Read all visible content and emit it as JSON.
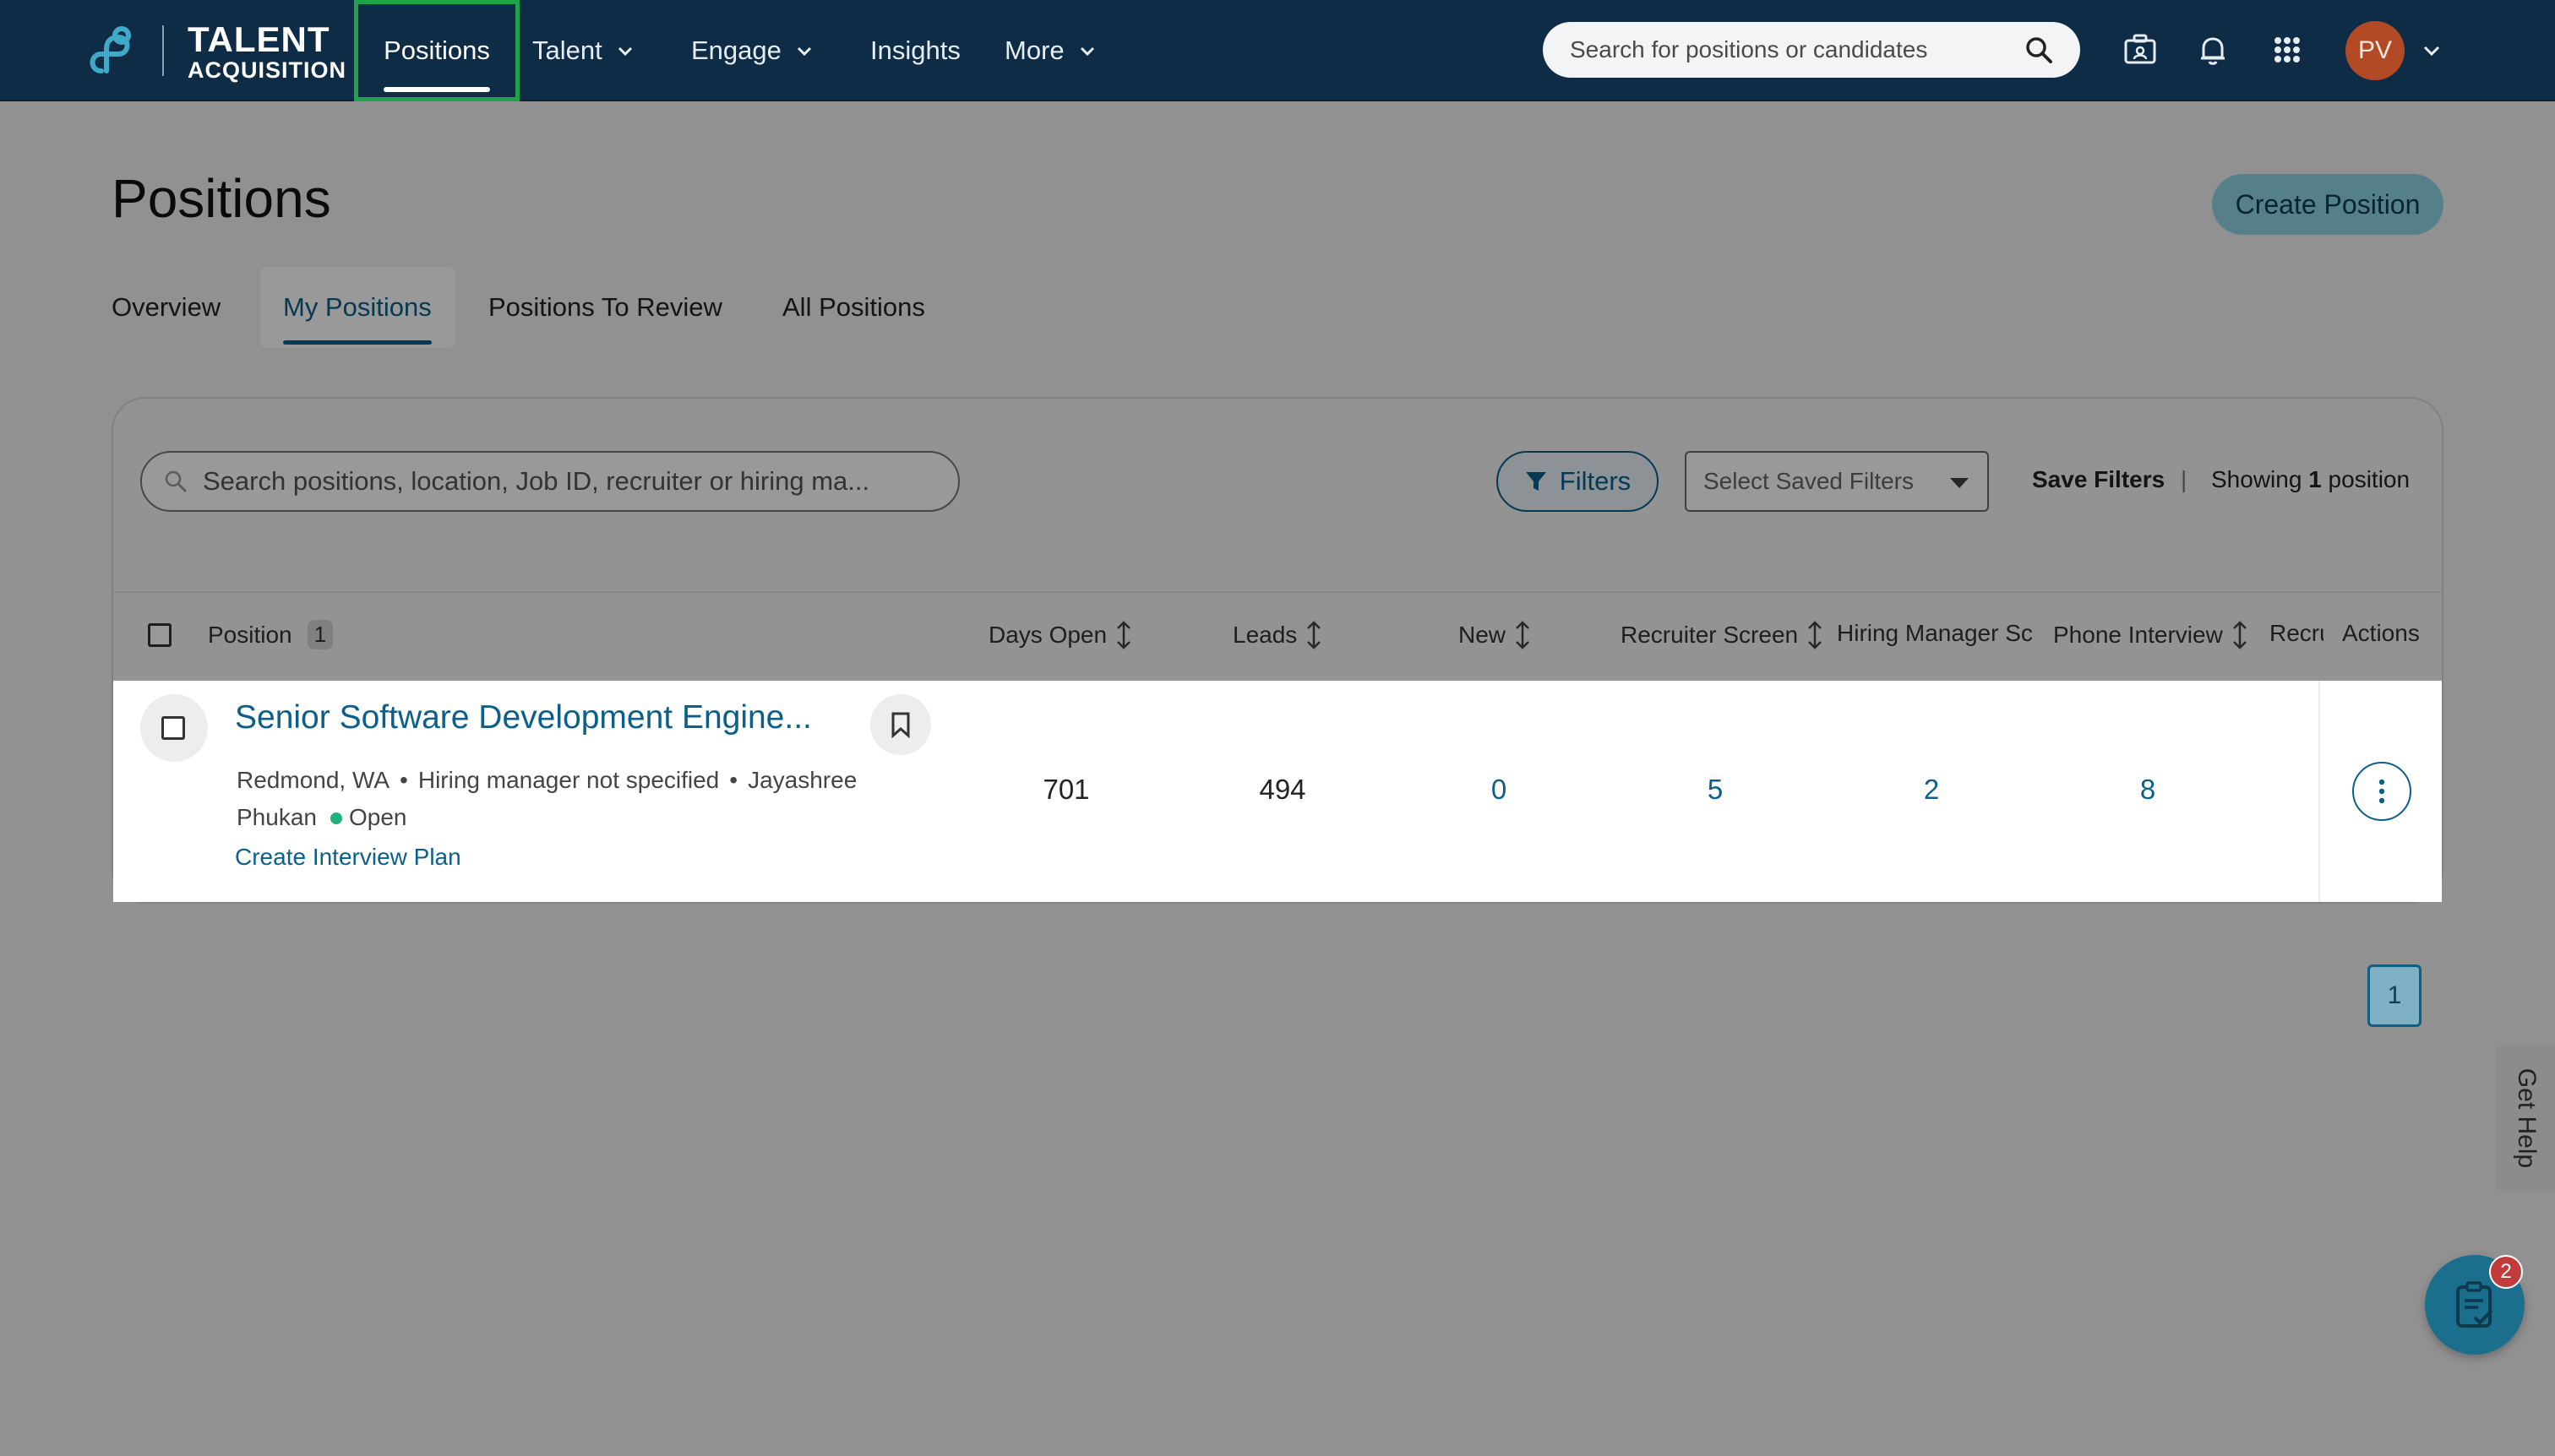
{
  "nav": {
    "brand_line1": "TALENT",
    "brand_line2": "ACQUISITION",
    "items": [
      {
        "label": "Positions"
      },
      {
        "label": "Talent"
      },
      {
        "label": "Engage"
      },
      {
        "label": "Insights"
      },
      {
        "label": "More"
      }
    ],
    "search_placeholder": "Search for positions or candidates",
    "avatar_initials": "PV",
    "icons": [
      "briefcase-icon",
      "bell-icon",
      "apps-grid-icon",
      "chevron-down-icon"
    ]
  },
  "page": {
    "title": "Positions",
    "create_button": "Create Position",
    "tabs": [
      {
        "label": "Overview"
      },
      {
        "label": "My Positions",
        "active": true
      },
      {
        "label": "Positions To Review"
      },
      {
        "label": "All Positions"
      }
    ]
  },
  "toolbar": {
    "search_placeholder": "Search positions, location, Job ID, recruiter or hiring ma...",
    "filters_label": "Filters",
    "saved_filters_placeholder": "Select Saved Filters",
    "save_filters_label": "Save Filters",
    "separator": "|",
    "showing_prefix": "Showing",
    "showing_count": "1",
    "showing_suffix": "position"
  },
  "table": {
    "columns": {
      "position": "Position",
      "position_count": "1",
      "days_open": "Days Open",
      "leads": "Leads",
      "new": "New",
      "recruiter_screen": "Recruiter Screen",
      "hiring_manager": "Hiring Manager Sc",
      "phone_interview": "Phone Interview",
      "recru": "Recru",
      "actions": "Actions"
    },
    "rows": [
      {
        "title": "Senior Software Development Engine...",
        "location": "Redmond, WA",
        "hiring_manager": "Hiring manager not specified",
        "recruiter": "Jayashree Phukan",
        "status": "Open",
        "interview_link": "Create Interview Plan",
        "days_open": "701",
        "leads": "494",
        "new": "0",
        "recruiter_screen": "5",
        "hiring_manager_screen": "2",
        "phone_interview": "8"
      }
    ]
  },
  "pagination": {
    "current_page": "1"
  },
  "help": {
    "label": "Get Help"
  },
  "fab": {
    "badge": "2"
  },
  "colors": {
    "nav_bg": "#0f2c46",
    "accent": "#0b5f8a",
    "highlight_border": "#1fa34a",
    "status_open": "#20b27a"
  }
}
